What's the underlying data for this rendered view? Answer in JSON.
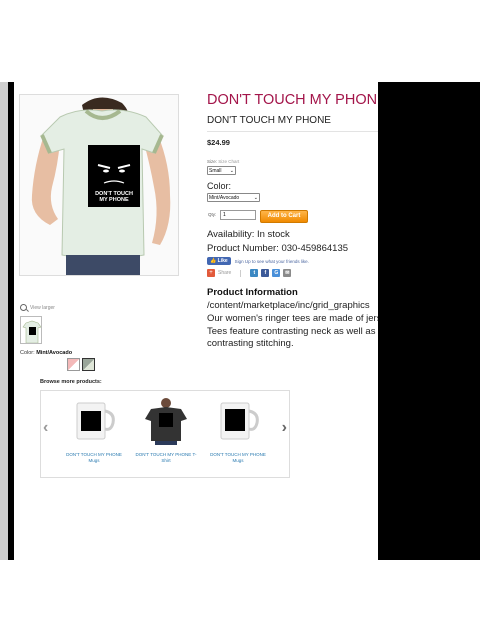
{
  "product": {
    "title": "DON'T TOUCH MY PHONE T-Shirt",
    "subtitle": "DON'T TOUCH MY PHONE",
    "price": "$24.99",
    "size_label": "Size:",
    "size_chart_link": "Size Chart",
    "size_value": "Small",
    "color_label": "Color:",
    "color_value": "Mint/Avocado",
    "qty_label": "Qty:",
    "qty_value": "1",
    "add_to_cart": "Add to Cart",
    "availability": "Availability: In stock",
    "product_number": "Product Number: 030-459864135",
    "fb_like": "Like",
    "fb_text": "Sign Up to see what your friends like.",
    "share_label": "Share",
    "info_heading": "Product Information",
    "info_path": "/content/marketplace/inc/grid_graphics",
    "info_text": "Our women's ringer tees are made of jersey. Tees feature contrasting neck as well as contrasting stitching."
  },
  "gallery": {
    "view_larger": "View larger",
    "design_line1": "DON'T TOUCH",
    "design_line2": "MY PHONE",
    "color_caption_label": "Color:",
    "color_caption_value": "Mint/Avocado"
  },
  "browse": {
    "label": "Browse more products:",
    "items": [
      {
        "caption": "DON'T TOUCH MY PHONE Mugs"
      },
      {
        "caption": "DON'T TOUCH MY PHONE T-Shirt"
      },
      {
        "caption": "DON'T TOUCH MY PHONE Mugs"
      }
    ]
  },
  "colors": {
    "title": "#a3154a",
    "cart_button": "#f08a00",
    "link": "#2a7ab0"
  }
}
